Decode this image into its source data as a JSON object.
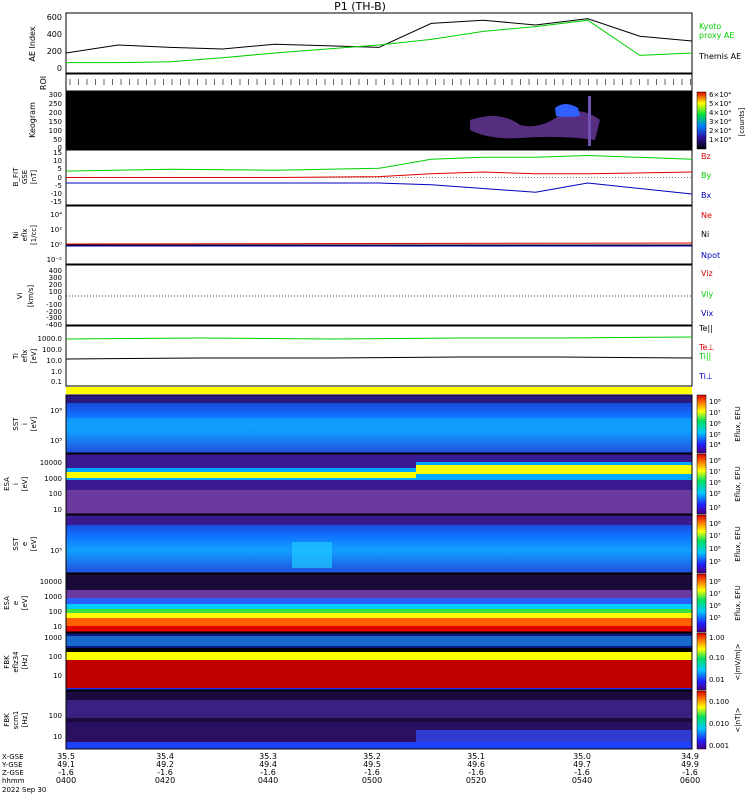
{
  "title": "P1  (TH-B)",
  "colors": {
    "green": "#00d000",
    "red": "#e00000",
    "blue": "#0000c0",
    "black": "#000000",
    "yellow": "#ffff00"
  },
  "panels": {
    "ae": {
      "ylabel": "AE Index",
      "ticks": [
        "600",
        "400",
        "200",
        "0"
      ],
      "legend_kyoto": [
        "Kyoto",
        "proxy AE"
      ],
      "legend_themis": "Themis AE"
    },
    "roi": {
      "ylabel": "ROI"
    },
    "keogram": {
      "ylabel": "Keogram",
      "ticks": [
        "300",
        "250",
        "200",
        "150",
        "100",
        "50",
        "0"
      ],
      "cbar_ticks": [
        "6×10⁴",
        "5×10⁴",
        "4×10⁴",
        "3×10⁴",
        "2×10⁴",
        "1×10⁴"
      ],
      "cbar_unit": "[counts]"
    },
    "bfield": {
      "ylabel": [
        "B_FIT",
        "GSE",
        "[nT]"
      ],
      "ticks": [
        "15",
        "10",
        "5",
        "0",
        "-5",
        "-10",
        "-15"
      ],
      "legend": [
        "Bz",
        "By",
        "Bx"
      ]
    },
    "density": {
      "ylabel": [
        "Ni",
        "eflx",
        "[1/cc]"
      ],
      "ticks": [
        "10⁴",
        "10²",
        "10⁰",
        "10⁻²"
      ],
      "legend": [
        "Ne",
        "Ni",
        "Npot"
      ]
    },
    "velocity": {
      "ylabel": [
        "Vi",
        "[km/s]"
      ],
      "ticks": [
        "400",
        "300",
        "200",
        "100",
        "0",
        "-100",
        "-200",
        "-300",
        "-400"
      ],
      "legend": [
        "Viz",
        "Viy",
        "Vix"
      ]
    },
    "temp": {
      "ylabel": [
        "Ti",
        "eflx",
        "[eV]"
      ],
      "ticks": [
        "1000.0",
        "100.0",
        "10.0",
        "1.0",
        "0.1"
      ],
      "legend": [
        "Te||",
        "Te⊥",
        "Ti||",
        "Ti⊥"
      ]
    },
    "sst_i": {
      "ylabel": [
        "SST",
        "i",
        "[eV]"
      ],
      "ticks": [
        "10⁶",
        "10⁵"
      ],
      "cbar_label": "Eflux, EFU"
    },
    "esa_i": {
      "ylabel": [
        "ESA",
        "i",
        "[eV]"
      ],
      "ticks": [
        "10000",
        "1000",
        "100",
        "10"
      ],
      "cbar_label": "Eflux, EFU"
    },
    "sst_e": {
      "ylabel": [
        "SST",
        "e",
        "[eV]"
      ],
      "ticks": [
        "10⁵"
      ],
      "cbar_label": "Eflux, EFU"
    },
    "esa_e": {
      "ylabel": [
        "ESA",
        "e",
        "[eV]"
      ],
      "ticks": [
        "10000",
        "1000",
        "100",
        "10"
      ],
      "cbar_label": "Eflux, EFU"
    },
    "fbk_e": {
      "ylabel": [
        "FBK",
        "eflz34",
        "[Hz]"
      ],
      "ticks": [
        "1000",
        "100",
        "10"
      ],
      "cbar_ticks": [
        "1.00",
        "0.10",
        "0.01"
      ],
      "cbar_label": "<|mV/m|>"
    },
    "fbk_b": {
      "ylabel": [
        "FBK",
        "scm1",
        "[Hz]"
      ],
      "ticks": [
        "100",
        "10"
      ],
      "cbar_ticks": [
        "0.100",
        "0.010",
        "0.001"
      ],
      "cbar_label": "<|nT|>"
    }
  },
  "eflux_cbar_ticks": [
    "10⁸",
    "10⁷",
    "10⁶",
    "10⁵",
    "10⁴",
    "10³"
  ],
  "footer": {
    "row_labels": [
      "X-GSE",
      "Y-GSE",
      "Z-GSE",
      "hhmm",
      "2022 Sep 30"
    ],
    "columns": [
      {
        "x": "35.5",
        "y": "49.1",
        "z": "-1.6",
        "t": "0400"
      },
      {
        "x": "35.4",
        "y": "49.2",
        "z": "-1.6",
        "t": "0420"
      },
      {
        "x": "35.3",
        "y": "49.4",
        "z": "-1.6",
        "t": "0440"
      },
      {
        "x": "35.2",
        "y": "49.5",
        "z": "-1.6",
        "t": "0500"
      },
      {
        "x": "35.1",
        "y": "49.6",
        "z": "-1.6",
        "t": "0520"
      },
      {
        "x": "35.0",
        "y": "49.7",
        "z": "-1.6",
        "t": "0540"
      },
      {
        "x": "34.9",
        "y": "49.9",
        "z": "-1.6",
        "t": "0600"
      }
    ]
  },
  "chart_data": {
    "type": "line",
    "title": "P1  (TH-B)",
    "x_time": [
      "0400",
      "0420",
      "0440",
      "0500",
      "0520",
      "0540",
      "0600"
    ],
    "ae_index": {
      "ylim": [
        -100,
        650
      ],
      "series": [
        {
          "name": "Themis AE",
          "x": [
            0,
            10,
            20,
            30,
            40,
            50,
            60,
            70,
            80,
            90,
            100,
            110,
            120
          ],
          "values": [
            150,
            250,
            220,
            200,
            260,
            240,
            220,
            520,
            560,
            500,
            580,
            360,
            300
          ]
        },
        {
          "name": "Kyoto proxy AE",
          "x": [
            0,
            10,
            20,
            30,
            40,
            50,
            60,
            70,
            80,
            90,
            100,
            110,
            120
          ],
          "values": [
            30,
            30,
            40,
            90,
            150,
            200,
            250,
            320,
            420,
            480,
            560,
            120,
            150
          ]
        }
      ]
    },
    "b_field": {
      "ylim": [
        -15,
        15
      ],
      "series": [
        {
          "name": "Bz",
          "x": [
            0,
            20,
            40,
            60,
            70,
            80,
            90,
            100,
            120
          ],
          "values": [
            0,
            0,
            0,
            0.5,
            2,
            3,
            2,
            2,
            3
          ]
        },
        {
          "name": "By",
          "x": [
            0,
            20,
            40,
            60,
            70,
            80,
            90,
            100,
            120
          ],
          "values": [
            3.5,
            4.5,
            4,
            5,
            10,
            11,
            11,
            12,
            10
          ]
        },
        {
          "name": "Bx",
          "x": [
            0,
            20,
            40,
            60,
            70,
            80,
            90,
            100,
            120
          ],
          "values": [
            -3,
            -3,
            -3,
            -3,
            -4,
            -6,
            -8,
            -3,
            -9
          ]
        }
      ]
    }
  }
}
